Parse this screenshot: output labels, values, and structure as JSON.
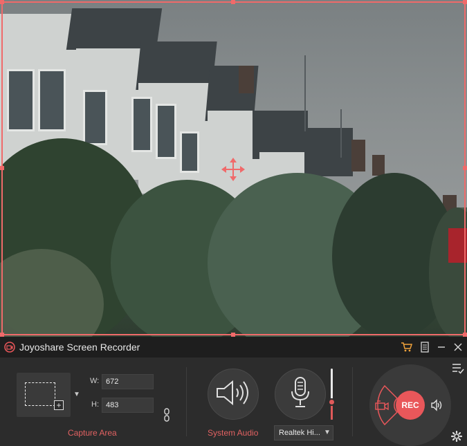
{
  "window": {
    "title": "Joyoshare Screen Recorder"
  },
  "capture_area": {
    "label": "Capture Area",
    "width_label": "W:",
    "width_value": "672",
    "height_label": "H:",
    "height_value": "483"
  },
  "audio": {
    "system_label": "System Audio",
    "mic_device": "Realtek Hi...",
    "mic_volume_fraction": 0.35
  },
  "record": {
    "rec_label": "REC"
  },
  "colors": {
    "accent": "#e9575a",
    "frame": "#f06a6a",
    "panel": "#2c2c2c",
    "titlebar": "#1e1e1e"
  },
  "icons": {
    "app": "camera-icon",
    "cart": "cart-icon",
    "doc": "document-icon",
    "minimize": "minimize-icon",
    "close": "close-icon",
    "speaker": "speaker-icon",
    "mic": "microphone-icon",
    "camera_mode": "camera-icon",
    "sound_mode": "speaker-small-icon",
    "list": "list-check-icon",
    "settings": "gear-icon",
    "move": "move-icon"
  }
}
